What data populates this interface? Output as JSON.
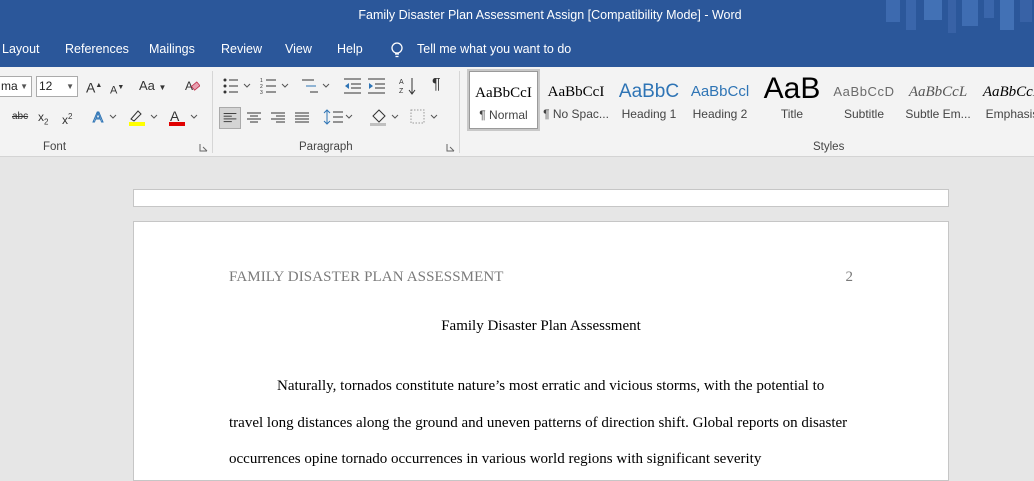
{
  "window": {
    "title": "Family Disaster Plan Assessment Assign [Compatibility Mode]  -  Word"
  },
  "menu": {
    "tabs": [
      "Layout",
      "References",
      "Mailings",
      "Review",
      "View",
      "Help"
    ],
    "tell_me": "Tell me what you want to do"
  },
  "ribbon": {
    "font": {
      "group_label": "Font",
      "font_name": "ma",
      "font_size": "12",
      "grow": "A",
      "shrink": "A",
      "case": "Aa",
      "strike": "abc",
      "subscript": "x",
      "sub_mark": "2",
      "superscript": "x",
      "sup_mark": "2",
      "font_color": "A"
    },
    "paragraph": {
      "group_label": "Paragraph",
      "show_marks": "¶"
    },
    "styles": {
      "group_label": "Styles",
      "items": [
        {
          "sample": "AaBbCcI",
          "name": "¶ Normal"
        },
        {
          "sample": "AaBbCcI",
          "name": "¶ No Spac..."
        },
        {
          "sample": "AaBbC",
          "name": "Heading 1"
        },
        {
          "sample": "AaBbCcl",
          "name": "Heading 2"
        },
        {
          "sample": "AaB",
          "name": "Title"
        },
        {
          "sample": "AaBbCcD",
          "name": "Subtitle"
        },
        {
          "sample": "AaBbCcL",
          "name": "Subtle Em..."
        },
        {
          "sample": "AaBbCcL",
          "name": "Emphasis"
        }
      ]
    }
  },
  "document": {
    "running_head": "FAMILY DISASTER PLAN ASSESSMENT",
    "page_number": "2",
    "title": "Family Disaster Plan Assessment",
    "paragraph": "Naturally, tornados constitute nature’s most erratic and vicious storms, with the potential to travel long distances along the ground and uneven patterns of direction shift. Global reports on disaster occurrences opine tornado occurrences in various world regions with significant severity"
  },
  "colors": {
    "titlebar": "#2b579a",
    "ribbon": "#f3f3f3",
    "canvas": "#e6e6e6",
    "heading": "#2e74b5"
  }
}
